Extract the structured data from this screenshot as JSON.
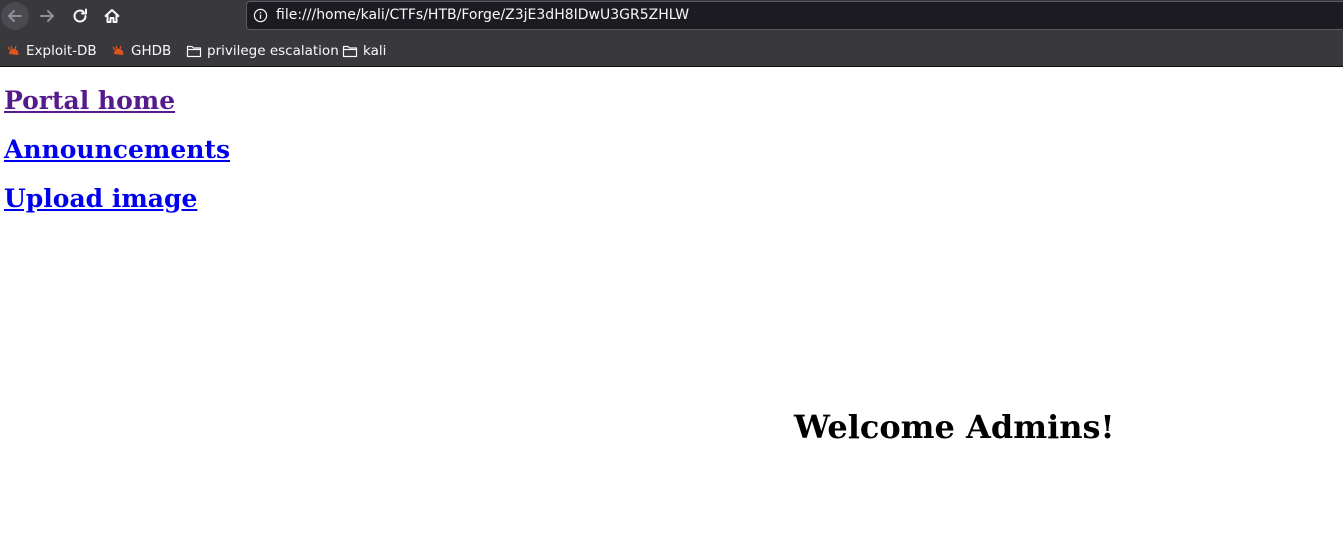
{
  "browser": {
    "url": "file:///home/kali/CTFs/HTB/Forge/Z3jE3dH8IDwU3GR5ZHLW",
    "bookmarks": [
      {
        "label": "Exploit-DB",
        "icon": "exploitdb-icon"
      },
      {
        "label": "GHDB",
        "icon": "ghdb-icon"
      },
      {
        "label": "privilege escalation",
        "icon": "folder-icon"
      },
      {
        "label": "kali",
        "icon": "folder-icon"
      }
    ],
    "colors": {
      "chrome": "#38383d",
      "urlbar": "#1c1b22",
      "text": "#f9f9fa",
      "bug": "#e0541e"
    }
  },
  "page": {
    "links": [
      {
        "label": "Portal home",
        "state": "visited"
      },
      {
        "label": "Announcements",
        "state": "unvisited"
      },
      {
        "label": "Upload image",
        "state": "unvisited"
      }
    ],
    "welcome": "Welcome Admins!",
    "colors": {
      "visited_link": "#551a8b",
      "link": "#0000ee"
    }
  }
}
